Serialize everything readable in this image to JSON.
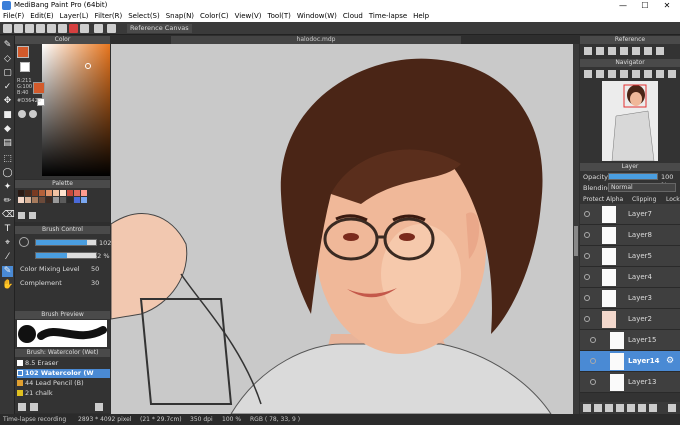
{
  "window": {
    "title": "MediBang Paint Pro (64bit)",
    "minimize": "—",
    "maximize": "☐",
    "close": "✕"
  },
  "menu": [
    "File(F)",
    "Edit(E)",
    "Layer(L)",
    "Filter(R)",
    "Select(S)",
    "Snap(N)",
    "Color(C)",
    "View(V)",
    "Tool(T)",
    "Window(W)",
    "Cloud",
    "Time-lapse",
    "Help"
  ],
  "toolbar": {
    "reference_canvas": "Reference Canvas"
  },
  "canvas": {
    "tab_title": "halodoc.mdp"
  },
  "color_panel": {
    "title": "Color",
    "r": "R:211",
    "g": "G:100",
    "b": "B:40",
    "hex": "#D36428",
    "fg": "#d35a2b",
    "bg": "#ffffff"
  },
  "palette": {
    "title": "Palette",
    "colors": [
      "#2b1a14",
      "#4a2a1c",
      "#7a3b22",
      "#b5613a",
      "#e0946a",
      "#f1c3a3",
      "#ffe3cf",
      "#c64a3c",
      "#e06a5d",
      "#ff9c8e",
      "#f4d7c7",
      "#d9b49a",
      "#a67a5c",
      "#6b4a3a",
      "#3c2a22",
      "#9a9a9a",
      "#5c5c5c",
      "#2b2b2b",
      "#4a6ad9",
      "#7aa7f0"
    ]
  },
  "brush_control": {
    "title": "Brush Control",
    "size": "102",
    "opacity": "52 %",
    "opacity_fraction": 0.52,
    "color_mixing_label": "Color Mixing Level",
    "color_mixing_value": "50",
    "complement_label": "Complement",
    "complement_value": "30"
  },
  "brush_preview": {
    "title": "Brush Preview"
  },
  "brush_list": {
    "title": "Brush: Watercolor (Wet)",
    "items": [
      {
        "size": "8.5",
        "name": "Eraser",
        "color": "#ffffff"
      },
      {
        "size": "102",
        "name": "Watercolor (W",
        "color": "#4a8ad4"
      },
      {
        "size": "44",
        "name": "Lead Pencil (B)",
        "color": "#e0a030"
      },
      {
        "size": "21",
        "name": "chalk",
        "color": "#e0c020"
      }
    ]
  },
  "reference_panel": {
    "title": "Reference"
  },
  "navigator_panel": {
    "title": "Navigator"
  },
  "layer_panel": {
    "title": "Layer",
    "opacity_label": "Opacity",
    "opacity_value": "100 %",
    "blending_label": "Blending",
    "blending_value": "Normal",
    "protect_alpha": "Protect Alpha",
    "clipping": "Clipping",
    "lock": "Lock",
    "layers": [
      "Layer7",
      "Layer8",
      "Layer5",
      "Layer4",
      "Layer3",
      "Layer2",
      "Layer15",
      "Layer14",
      "Layer13"
    ]
  },
  "status": {
    "recording": "Time-lapse recording",
    "dimensions": "2893 * 4092 pixel",
    "physical": "(21 * 29.7cm)",
    "dpi": "350 dpi",
    "zoom": "100 %",
    "rgb": "RGB ( 78, 33, 9 )"
  }
}
